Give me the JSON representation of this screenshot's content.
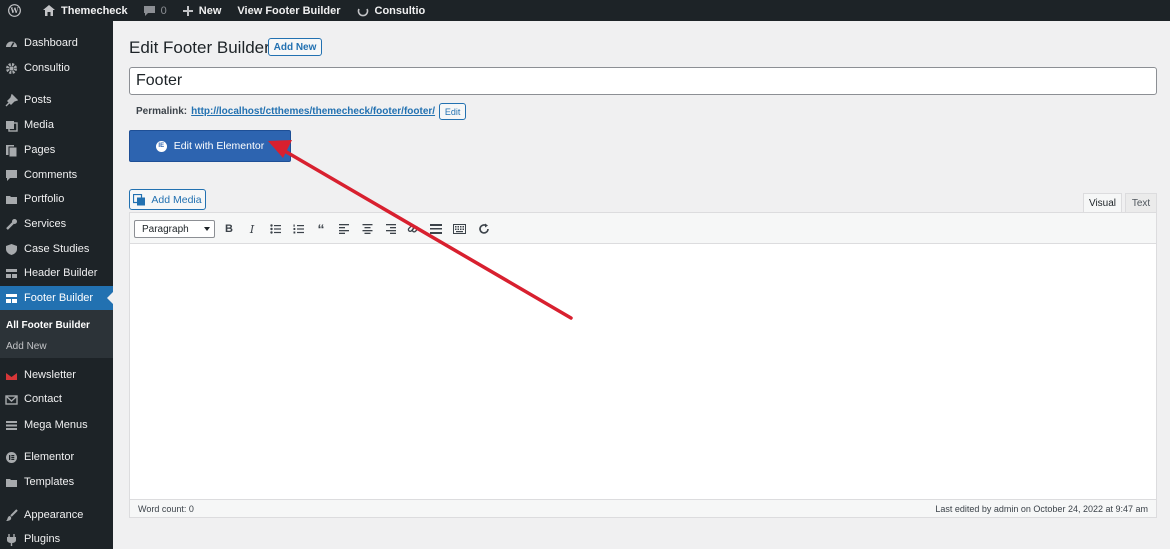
{
  "adminbar": {
    "site_name": "Themecheck",
    "comments_count": "0",
    "new_label": "New",
    "view_label": "View Footer Builder",
    "theme_label": "Consultio"
  },
  "sidebar": {
    "items": [
      {
        "label": "Dashboard",
        "icon": "dashboard-icon"
      },
      {
        "label": "Consultio",
        "icon": "gear-icon"
      },
      {
        "label": "Posts",
        "icon": "pin-icon"
      },
      {
        "label": "Media",
        "icon": "media-icon"
      },
      {
        "label": "Pages",
        "icon": "pages-icon"
      },
      {
        "label": "Comments",
        "icon": "comment-icon"
      },
      {
        "label": "Portfolio",
        "icon": "folder-icon"
      },
      {
        "label": "Services",
        "icon": "wrench-icon"
      },
      {
        "label": "Case Studies",
        "icon": "shield-icon"
      },
      {
        "label": "Header Builder",
        "icon": "layout-icon"
      },
      {
        "label": "Footer Builder",
        "icon": "layout-icon"
      },
      {
        "label": "Newsletter",
        "icon": "newsletter-icon"
      },
      {
        "label": "Contact",
        "icon": "mail-icon"
      },
      {
        "label": "Mega Menus",
        "icon": "menu-icon"
      },
      {
        "label": "Elementor",
        "icon": "elementor-icon"
      },
      {
        "label": "Templates",
        "icon": "folder-icon"
      },
      {
        "label": "Appearance",
        "icon": "brush-icon"
      },
      {
        "label": "Plugins",
        "icon": "plugin-icon"
      }
    ],
    "submenu": [
      "All Footer Builder",
      "Add New"
    ]
  },
  "main": {
    "page_title": "Edit Footer Builder",
    "add_new_label": "Add New",
    "post_title": "Footer",
    "permalink_label": "Permalink:",
    "permalink_url": "http://localhost/ctthemes/themecheck/footer/footer/",
    "permalink_edit_label": "Edit",
    "elementor_button_label": "Edit with Elementor",
    "add_media_label": "Add Media",
    "tab_visual": "Visual",
    "tab_text": "Text",
    "format_select_value": "Paragraph",
    "word_count": "Word count: 0",
    "last_edited": "Last edited by admin on October 24, 2022 at 9:47 am"
  },
  "colors": {
    "admin_bg": "#1d2327",
    "accent": "#2271b1",
    "elementor_button": "#2d64b0",
    "annotation_arrow": "#d8202f"
  }
}
